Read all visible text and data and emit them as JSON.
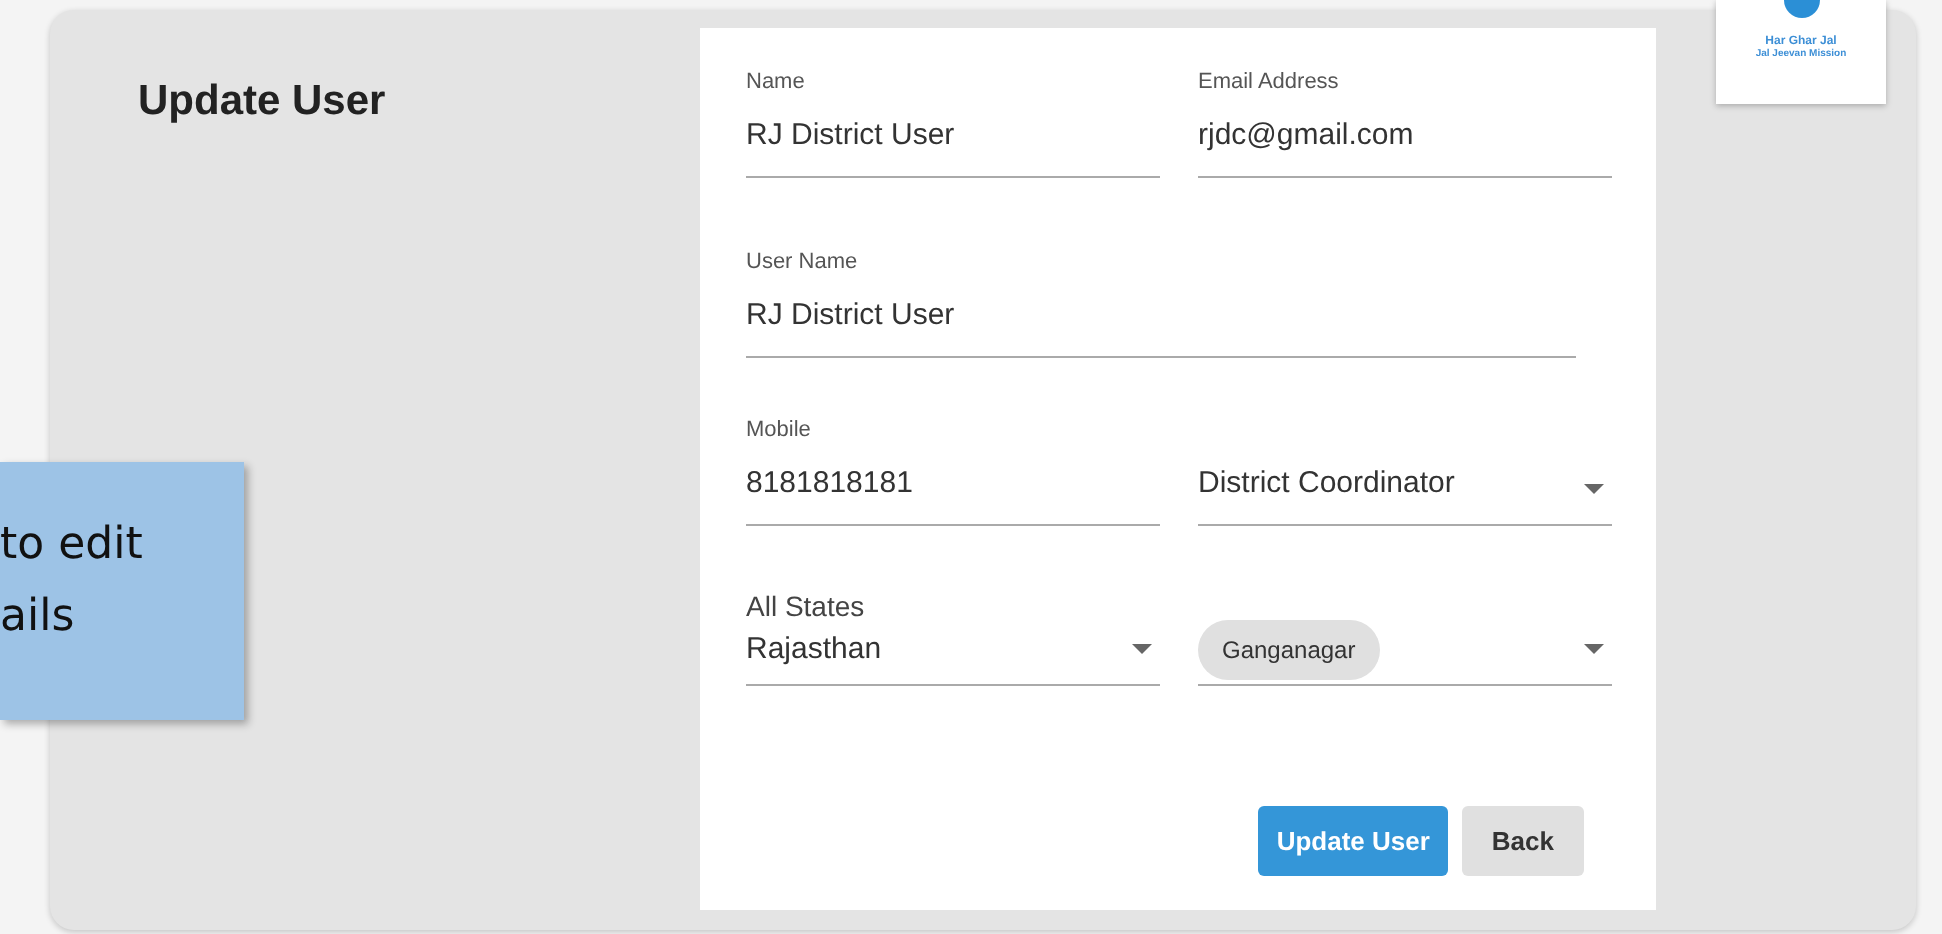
{
  "page": {
    "title": "Update User"
  },
  "logo": {
    "line_1": "Har Ghar Jal",
    "line_2": "Jal Jeevan Mission"
  },
  "callout": {
    "lines": [
      "to edit",
      "ails"
    ]
  },
  "form": {
    "rows": [
      {
        "fields": [
          {
            "kind": "text",
            "label": "Name",
            "value": "RJ District User"
          },
          {
            "kind": "text",
            "label": "Email Address",
            "value": "rjdc@gmail.com"
          }
        ]
      },
      {
        "fields": [
          {
            "kind": "text",
            "label": "User Name",
            "value": "RJ District User"
          }
        ]
      },
      {
        "fields": [
          {
            "kind": "text",
            "label": "Mobile",
            "value": "8181818181"
          },
          {
            "kind": "select",
            "value": "District Coordinator"
          }
        ]
      },
      {
        "fields": [
          {
            "kind": "select",
            "label": "All States",
            "value": "Rajasthan"
          },
          {
            "kind": "chips",
            "chips": [
              "Ganganagar"
            ]
          }
        ]
      }
    ]
  },
  "buttons": [
    {
      "label": "Update User",
      "kind": "primary"
    },
    {
      "label": "Back",
      "kind": "secondary"
    }
  ]
}
